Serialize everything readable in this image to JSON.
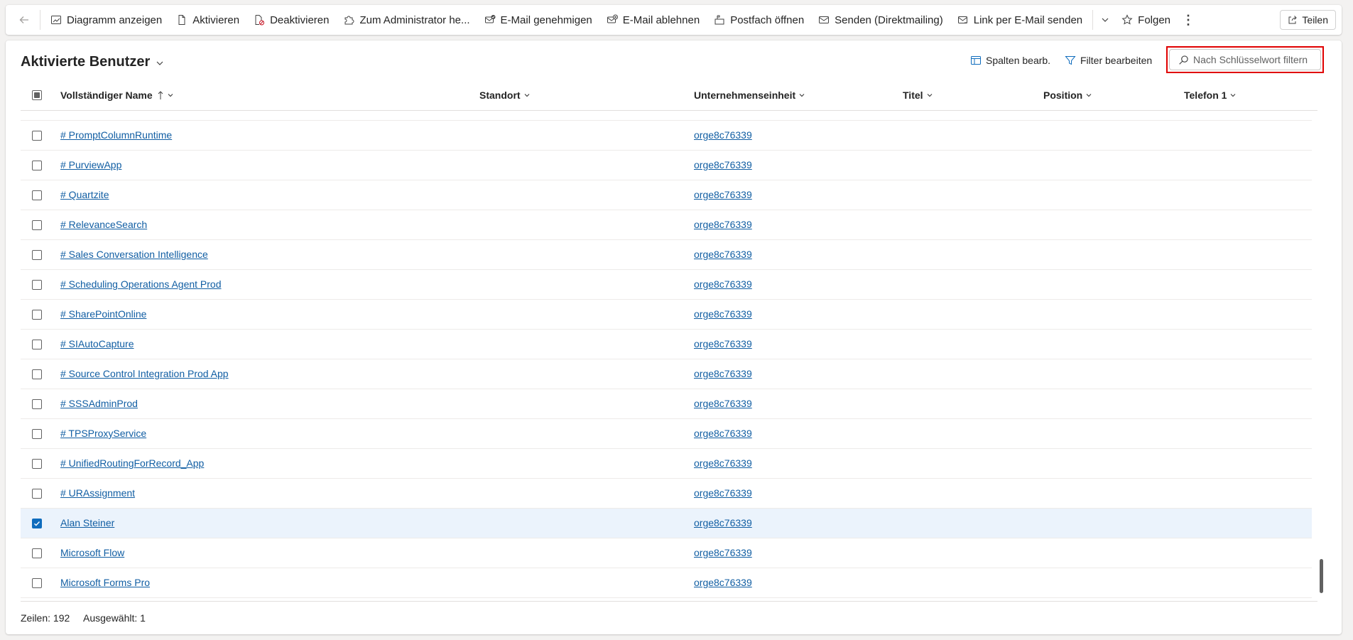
{
  "commandbar": {
    "items": [
      {
        "label": "Diagramm anzeigen",
        "icon": "chart-icon"
      },
      {
        "label": "Aktivieren",
        "icon": "document-icon"
      },
      {
        "label": "Deaktivieren",
        "icon": "document-block-icon"
      },
      {
        "label": "Zum Administrator he...",
        "icon": "puzzle-icon"
      },
      {
        "label": "E-Mail genehmigen",
        "icon": "mail-check-icon"
      },
      {
        "label": "E-Mail ablehnen",
        "icon": "mail-dismiss-icon"
      },
      {
        "label": "Postfach öffnen",
        "icon": "mailbox-icon"
      },
      {
        "label": "Senden (Direktmailing)",
        "icon": "mail-send-icon"
      },
      {
        "label": "Link per E-Mail senden",
        "icon": "mail-link-icon"
      }
    ],
    "follow_label": "Folgen",
    "share_label": "Teilen"
  },
  "view": {
    "title": "Aktivierte Benutzer",
    "edit_columns_label": "Spalten bearb.",
    "edit_filters_label": "Filter bearbeiten",
    "search_placeholder": "Nach Schlüsselwort filtern"
  },
  "grid": {
    "columns": [
      "Vollständiger Name",
      "Standort",
      "Unternehmenseinheit",
      "Titel",
      "Position",
      "Telefon 1"
    ],
    "rows": [
      {
        "name": "# PromptColumnRuntime",
        "unit": "orge8c76339",
        "selected": false
      },
      {
        "name": "# PurviewApp",
        "unit": "orge8c76339",
        "selected": false
      },
      {
        "name": "# Quartzite",
        "unit": "orge8c76339",
        "selected": false
      },
      {
        "name": "# RelevanceSearch",
        "unit": "orge8c76339",
        "selected": false
      },
      {
        "name": "# Sales Conversation Intelligence",
        "unit": "orge8c76339",
        "selected": false
      },
      {
        "name": "# Scheduling Operations Agent Prod",
        "unit": "orge8c76339",
        "selected": false
      },
      {
        "name": "# SharePointOnline",
        "unit": "orge8c76339",
        "selected": false
      },
      {
        "name": "# SIAutoCapture",
        "unit": "orge8c76339",
        "selected": false
      },
      {
        "name": "# Source Control Integration Prod App",
        "unit": "orge8c76339",
        "selected": false
      },
      {
        "name": "# SSSAdminProd",
        "unit": "orge8c76339",
        "selected": false
      },
      {
        "name": "# TPSProxyService",
        "unit": "orge8c76339",
        "selected": false
      },
      {
        "name": "# UnifiedRoutingForRecord_App",
        "unit": "orge8c76339",
        "selected": false
      },
      {
        "name": "# URAssignment",
        "unit": "orge8c76339",
        "selected": false
      },
      {
        "name": "Alan Steiner",
        "unit": "orge8c76339",
        "selected": true
      },
      {
        "name": "Microsoft Flow",
        "unit": "orge8c76339",
        "selected": false
      },
      {
        "name": "Microsoft Forms Pro",
        "unit": "orge8c76339",
        "selected": false
      }
    ]
  },
  "footer": {
    "rows_label": "Zeilen: 192",
    "selected_label": "Ausgewählt: 1"
  },
  "colors": {
    "accent": "#0f6cbd",
    "link": "#115ea3",
    "selected_row": "#ebf3fc",
    "highlight": "#e00000"
  }
}
